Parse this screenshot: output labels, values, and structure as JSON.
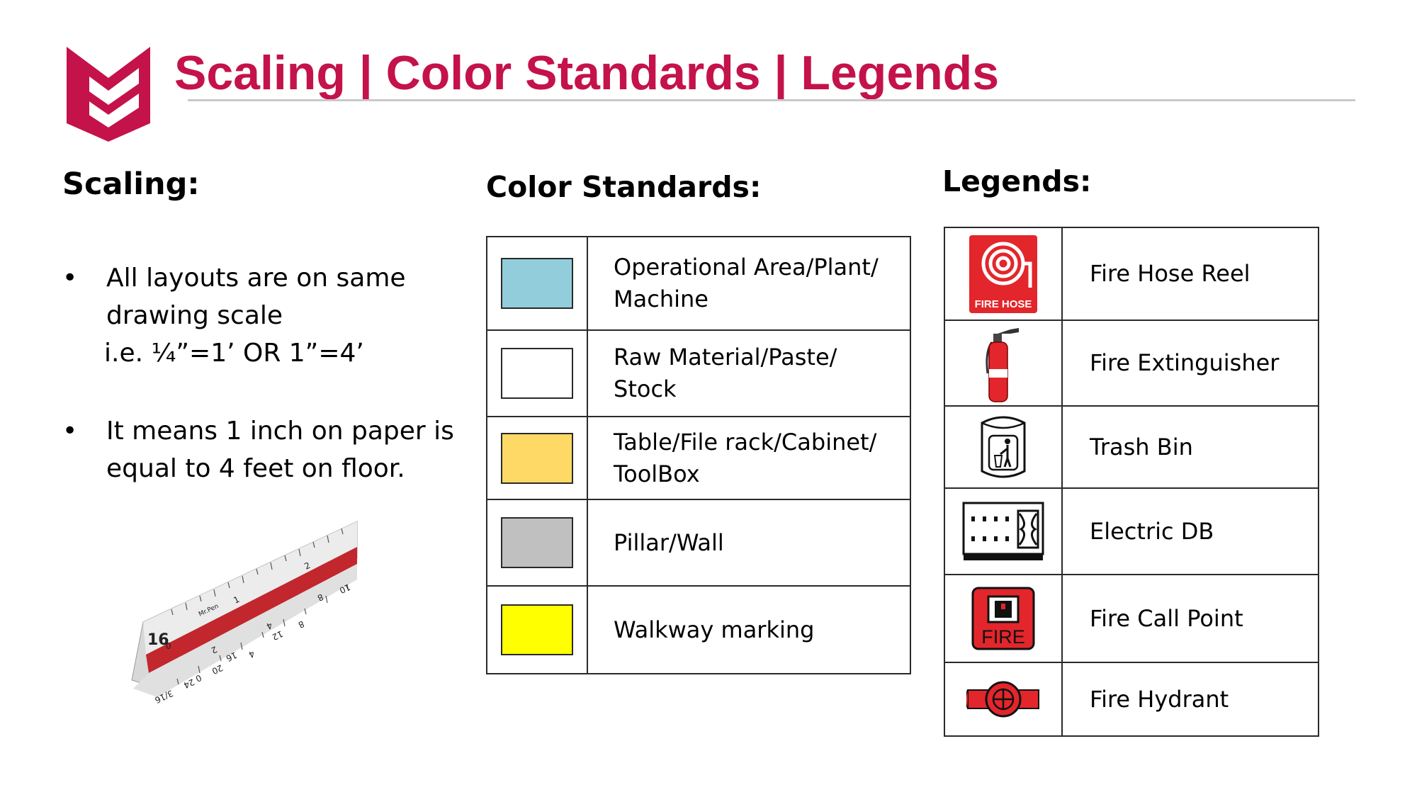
{
  "header": {
    "title": "Scaling | Color Standards | Legends",
    "accent_color": "#c4124a"
  },
  "scaling": {
    "heading": "Scaling:",
    "bullets": [
      {
        "lines": [
          "All layouts are on same",
          "drawing scale",
          "i.e. ¼”=1’ OR 1”=4’"
        ]
      },
      {
        "lines": [
          "It means 1 inch on paper is",
          "equal to 4 feet on floor."
        ]
      }
    ],
    "ruler": {
      "icon": "architect-scale-ruler-icon",
      "labels": [
        "16",
        "0",
        "1",
        "2",
        "3/16",
        "0",
        "4",
        "8",
        "12",
        "16",
        "20",
        "24",
        "2",
        "4",
        "8",
        "10",
        "Mr.Pen"
      ]
    }
  },
  "color_standards": {
    "heading": "Color Standards:",
    "rows": [
      {
        "color": "#92cddc",
        "lines": [
          "Operational Area/Plant/",
          "Machine"
        ]
      },
      {
        "color": "#ffffff",
        "lines": [
          "Raw Material/Paste/",
          "Stock"
        ]
      },
      {
        "color": "#ffd966",
        "lines": [
          "Table/File rack/Cabinet/",
          "ToolBox"
        ]
      },
      {
        "color": "#c0c0c0",
        "lines": [
          "Pillar/Wall"
        ]
      },
      {
        "color": "#ffff00",
        "lines": [
          "Walkway marking"
        ]
      }
    ]
  },
  "legends": {
    "heading": "Legends:",
    "rows": [
      {
        "icon": "fire-hose-reel-icon",
        "label": "Fire Hose Reel",
        "icon_text": "FIRE HOSE"
      },
      {
        "icon": "fire-extinguisher-icon",
        "label": "Fire Extinguisher"
      },
      {
        "icon": "trash-bin-icon",
        "label": "Trash Bin"
      },
      {
        "icon": "electric-db-icon",
        "label": "Electric DB"
      },
      {
        "icon": "fire-call-point-icon",
        "label": "Fire Call Point",
        "icon_text": "FIRE"
      },
      {
        "icon": "fire-hydrant-icon",
        "label": "Fire Hydrant"
      }
    ]
  }
}
